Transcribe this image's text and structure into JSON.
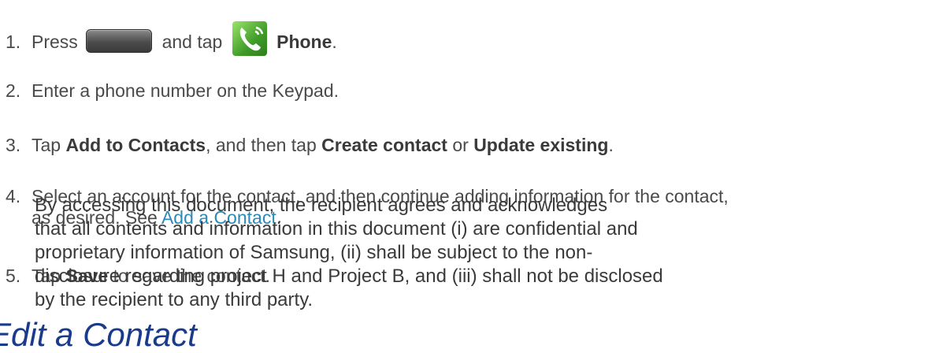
{
  "steps": [
    {
      "num": "1.",
      "a": "Press",
      "b": "and tap",
      "c": "Phone",
      "d": "."
    },
    {
      "num": "2.",
      "text": "Enter a phone number on the Keypad."
    },
    {
      "num": "3.",
      "a": "Tap ",
      "b": "Add to Contacts",
      "c": ", and then tap ",
      "d": "Create contact",
      "e": " or ",
      "f": "Update existing",
      "g": "."
    },
    {
      "num": "4.",
      "line1": "Select an account for the contact, and then continue adding information for the contact,",
      "line2a": "as desired. See ",
      "link": "Add a Contact",
      "line2b": "."
    },
    {
      "num": "5.",
      "a": "Tap ",
      "b": "Save",
      "c": " to save the contact."
    }
  ],
  "watermark": [
    "By accessing this document, the recipient agrees and acknowledges",
    "that all contents and information in this document (i) are confidential and",
    "proprietary information of Samsung, (ii) shall be subject to the non-",
    "disclosure regarding project H and Project B, and (iii) shall not be disclosed",
    "by the recipient to any third party."
  ],
  "heading": "Edit a Contact",
  "icons": {
    "home_button": "home-key-icon",
    "phone_app": "phone-app-icon"
  }
}
